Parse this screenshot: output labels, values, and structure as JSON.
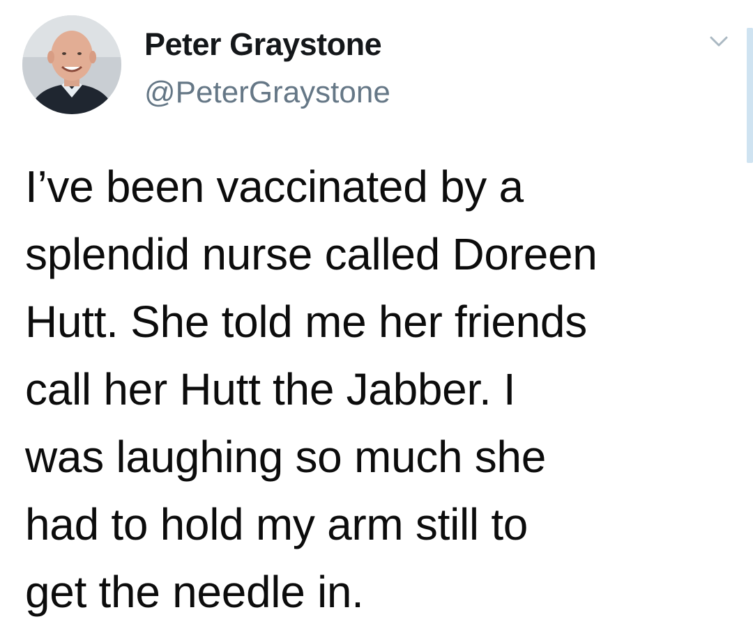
{
  "author": {
    "display_name": "Peter Graystone",
    "handle": "@PeterGraystone",
    "avatar_icon": "user-avatar-photo"
  },
  "menu": {
    "icon": "chevron-down-icon",
    "color": "#aab8c2"
  },
  "tweet": {
    "lines": [
      "I’ve been vaccinated by a",
      "splendid nurse called Doreen",
      "Hutt. She told me her friends",
      "call her Hutt the Jabber. I",
      "was laughing so much she",
      "had to hold my arm still to",
      "get the needle in."
    ]
  },
  "colors": {
    "text": "#14171a",
    "secondary": "#657786",
    "scroll_accent": "#cfe3f1"
  }
}
